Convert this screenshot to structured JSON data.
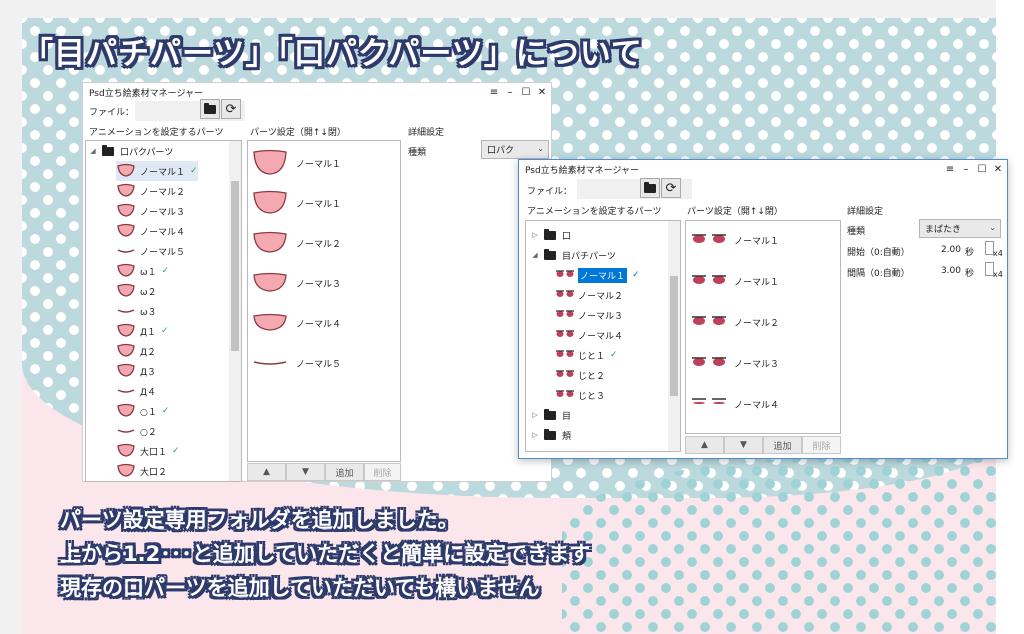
{
  "headline": "「目パチパーツ」「口パクパーツ」について",
  "footer_lines": [
    "パーツ設定専用フォルダを追加しました。",
    "上から1.2･･･と追加していただくと簡単に設定できます",
    "現存の口パーツを追加していただいても構いません"
  ],
  "colors": {
    "teal_bg": "#bcd9dd",
    "pink_bg": "#fbe6ec",
    "headline_outline": "#2d3a6b",
    "selection": "#0078d7",
    "check": "#35a06a"
  },
  "window_back": {
    "title": "Psd立ち絵素材マネージャー",
    "file_label": "ファイル：",
    "anim_label": "アニメーションを設定するパーツ",
    "parts_label": "パーツ設定（開↑↓閉）",
    "detail_label": "詳細設定",
    "type_label": "種類",
    "type_value": "口パク",
    "tree_root": "口パクパーツ",
    "tree_items": [
      {
        "label": "ノーマル１",
        "check": true,
        "icon": "mouth-open-icon"
      },
      {
        "label": "ノーマル２",
        "check": false,
        "icon": "mouth-half-icon"
      },
      {
        "label": "ノーマル３",
        "check": false,
        "icon": "mouth-small-icon"
      },
      {
        "label": "ノーマル４",
        "check": false,
        "icon": "mouth-smile-icon"
      },
      {
        "label": "ノーマル５",
        "check": false,
        "icon": "mouth-line-icon"
      },
      {
        "label": "ω１",
        "check": true,
        "icon": "mouth-cat-icon"
      },
      {
        "label": "ω２",
        "check": false,
        "icon": "mouth-cat-small-icon"
      },
      {
        "label": "ω３",
        "check": false,
        "icon": "mouth-cat-line-icon"
      },
      {
        "label": "Д１",
        "check": true,
        "icon": "mouth-square-icon"
      },
      {
        "label": "Д２",
        "check": false,
        "icon": "mouth-square-half-icon"
      },
      {
        "label": "Д３",
        "check": false,
        "icon": "mouth-square-small-icon"
      },
      {
        "label": "Д４",
        "check": false,
        "icon": "mouth-square-line-icon"
      },
      {
        "label": "○１",
        "check": true,
        "icon": "mouth-round-icon"
      },
      {
        "label": "○２",
        "check": false,
        "icon": "mouth-round-line-icon"
      },
      {
        "label": "大口１",
        "check": true,
        "icon": "mouth-big-icon"
      },
      {
        "label": "大口２",
        "check": false,
        "icon": "mouth-big-half-icon"
      }
    ],
    "parts": [
      {
        "label": "ノーマル１"
      },
      {
        "label": "ノーマル１"
      },
      {
        "label": "ノーマル２"
      },
      {
        "label": "ノーマル３"
      },
      {
        "label": "ノーマル４"
      },
      {
        "label": "ノーマル５"
      }
    ],
    "buttons": {
      "up": "▲",
      "down": "▼",
      "add": "追加",
      "remove": "削除"
    }
  },
  "window_front": {
    "title": "Psd立ち絵素材マネージャー",
    "file_label": "ファイル：",
    "anim_label": "アニメーションを設定するパーツ",
    "parts_label": "パーツ設定（開↑↓閉）",
    "detail_label": "詳細設定",
    "type_label": "種類",
    "type_value": "まばたき",
    "start_label": "開始（0:自動）",
    "start_value": "2.00",
    "interval_label": "間隔（0:自動）",
    "interval_value": "3.00",
    "unit": "秒",
    "spin_suffix": "x4",
    "tree": [
      {
        "label": "口",
        "type": "folder",
        "expanded": false
      },
      {
        "label": "目パチパーツ",
        "type": "folder",
        "expanded": true
      },
      {
        "label": "ノーマル１",
        "type": "item",
        "check": true,
        "selected": true
      },
      {
        "label": "ノーマル２",
        "type": "item",
        "check": false
      },
      {
        "label": "ノーマル３",
        "type": "item",
        "check": false
      },
      {
        "label": "ノーマル４",
        "type": "item",
        "check": false
      },
      {
        "label": "じと１",
        "type": "item",
        "check": true
      },
      {
        "label": "じと２",
        "type": "item",
        "check": false
      },
      {
        "label": "じと３",
        "type": "item",
        "check": false
      },
      {
        "label": "目",
        "type": "folder",
        "expanded": false
      },
      {
        "label": "頬",
        "type": "folder",
        "expanded": false
      }
    ],
    "parts": [
      {
        "label": "ノーマル１"
      },
      {
        "label": "ノーマル１"
      },
      {
        "label": "ノーマル２"
      },
      {
        "label": "ノーマル３"
      },
      {
        "label": "ノーマル４"
      }
    ],
    "buttons": {
      "up": "▲",
      "down": "▼",
      "add": "追加",
      "remove": "削除"
    }
  }
}
